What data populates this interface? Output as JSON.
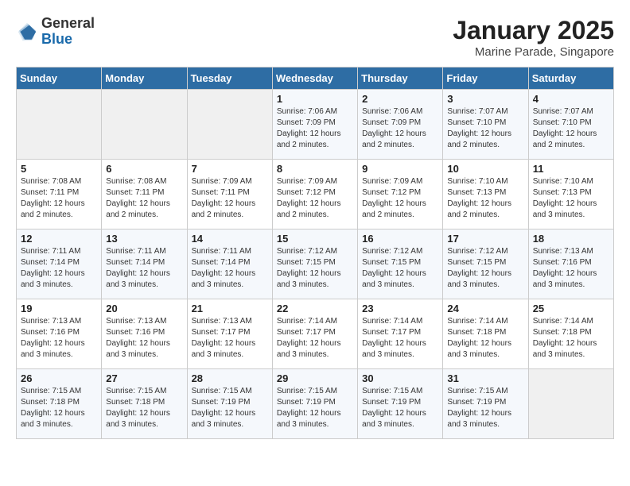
{
  "header": {
    "logo_general": "General",
    "logo_blue": "Blue",
    "title": "January 2025",
    "subtitle": "Marine Parade, Singapore"
  },
  "days_of_week": [
    "Sunday",
    "Monday",
    "Tuesday",
    "Wednesday",
    "Thursday",
    "Friday",
    "Saturday"
  ],
  "weeks": [
    [
      {
        "day": "",
        "info": ""
      },
      {
        "day": "",
        "info": ""
      },
      {
        "day": "",
        "info": ""
      },
      {
        "day": "1",
        "info": "Sunrise: 7:06 AM\nSunset: 7:09 PM\nDaylight: 12 hours\nand 2 minutes."
      },
      {
        "day": "2",
        "info": "Sunrise: 7:06 AM\nSunset: 7:09 PM\nDaylight: 12 hours\nand 2 minutes."
      },
      {
        "day": "3",
        "info": "Sunrise: 7:07 AM\nSunset: 7:10 PM\nDaylight: 12 hours\nand 2 minutes."
      },
      {
        "day": "4",
        "info": "Sunrise: 7:07 AM\nSunset: 7:10 PM\nDaylight: 12 hours\nand 2 minutes."
      }
    ],
    [
      {
        "day": "5",
        "info": "Sunrise: 7:08 AM\nSunset: 7:11 PM\nDaylight: 12 hours\nand 2 minutes."
      },
      {
        "day": "6",
        "info": "Sunrise: 7:08 AM\nSunset: 7:11 PM\nDaylight: 12 hours\nand 2 minutes."
      },
      {
        "day": "7",
        "info": "Sunrise: 7:09 AM\nSunset: 7:11 PM\nDaylight: 12 hours\nand 2 minutes."
      },
      {
        "day": "8",
        "info": "Sunrise: 7:09 AM\nSunset: 7:12 PM\nDaylight: 12 hours\nand 2 minutes."
      },
      {
        "day": "9",
        "info": "Sunrise: 7:09 AM\nSunset: 7:12 PM\nDaylight: 12 hours\nand 2 minutes."
      },
      {
        "day": "10",
        "info": "Sunrise: 7:10 AM\nSunset: 7:13 PM\nDaylight: 12 hours\nand 2 minutes."
      },
      {
        "day": "11",
        "info": "Sunrise: 7:10 AM\nSunset: 7:13 PM\nDaylight: 12 hours\nand 3 minutes."
      }
    ],
    [
      {
        "day": "12",
        "info": "Sunrise: 7:11 AM\nSunset: 7:14 PM\nDaylight: 12 hours\nand 3 minutes."
      },
      {
        "day": "13",
        "info": "Sunrise: 7:11 AM\nSunset: 7:14 PM\nDaylight: 12 hours\nand 3 minutes."
      },
      {
        "day": "14",
        "info": "Sunrise: 7:11 AM\nSunset: 7:14 PM\nDaylight: 12 hours\nand 3 minutes."
      },
      {
        "day": "15",
        "info": "Sunrise: 7:12 AM\nSunset: 7:15 PM\nDaylight: 12 hours\nand 3 minutes."
      },
      {
        "day": "16",
        "info": "Sunrise: 7:12 AM\nSunset: 7:15 PM\nDaylight: 12 hours\nand 3 minutes."
      },
      {
        "day": "17",
        "info": "Sunrise: 7:12 AM\nSunset: 7:15 PM\nDaylight: 12 hours\nand 3 minutes."
      },
      {
        "day": "18",
        "info": "Sunrise: 7:13 AM\nSunset: 7:16 PM\nDaylight: 12 hours\nand 3 minutes."
      }
    ],
    [
      {
        "day": "19",
        "info": "Sunrise: 7:13 AM\nSunset: 7:16 PM\nDaylight: 12 hours\nand 3 minutes."
      },
      {
        "day": "20",
        "info": "Sunrise: 7:13 AM\nSunset: 7:16 PM\nDaylight: 12 hours\nand 3 minutes."
      },
      {
        "day": "21",
        "info": "Sunrise: 7:13 AM\nSunset: 7:17 PM\nDaylight: 12 hours\nand 3 minutes."
      },
      {
        "day": "22",
        "info": "Sunrise: 7:14 AM\nSunset: 7:17 PM\nDaylight: 12 hours\nand 3 minutes."
      },
      {
        "day": "23",
        "info": "Sunrise: 7:14 AM\nSunset: 7:17 PM\nDaylight: 12 hours\nand 3 minutes."
      },
      {
        "day": "24",
        "info": "Sunrise: 7:14 AM\nSunset: 7:18 PM\nDaylight: 12 hours\nand 3 minutes."
      },
      {
        "day": "25",
        "info": "Sunrise: 7:14 AM\nSunset: 7:18 PM\nDaylight: 12 hours\nand 3 minutes."
      }
    ],
    [
      {
        "day": "26",
        "info": "Sunrise: 7:15 AM\nSunset: 7:18 PM\nDaylight: 12 hours\nand 3 minutes."
      },
      {
        "day": "27",
        "info": "Sunrise: 7:15 AM\nSunset: 7:18 PM\nDaylight: 12 hours\nand 3 minutes."
      },
      {
        "day": "28",
        "info": "Sunrise: 7:15 AM\nSunset: 7:19 PM\nDaylight: 12 hours\nand 3 minutes."
      },
      {
        "day": "29",
        "info": "Sunrise: 7:15 AM\nSunset: 7:19 PM\nDaylight: 12 hours\nand 3 minutes."
      },
      {
        "day": "30",
        "info": "Sunrise: 7:15 AM\nSunset: 7:19 PM\nDaylight: 12 hours\nand 3 minutes."
      },
      {
        "day": "31",
        "info": "Sunrise: 7:15 AM\nSunset: 7:19 PM\nDaylight: 12 hours\nand 3 minutes."
      },
      {
        "day": "",
        "info": ""
      }
    ]
  ]
}
